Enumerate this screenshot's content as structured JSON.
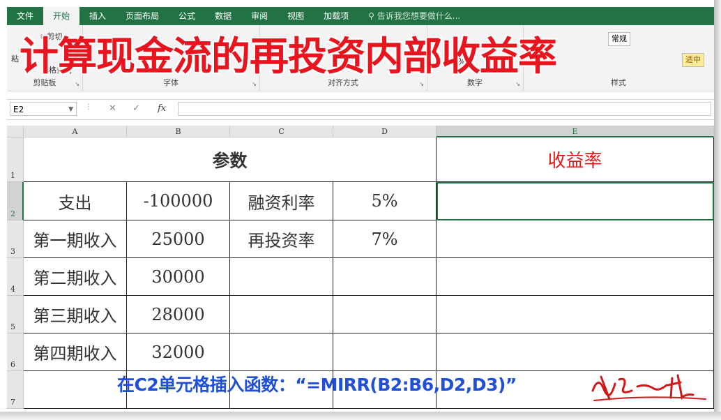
{
  "ribbon_tabs": [
    "文件",
    "开始",
    "插入",
    "页面布局",
    "公式",
    "数据",
    "审阅",
    "视图",
    "加载项"
  ],
  "tell_me": "告诉我您想要做什么...",
  "ribbon_groups": {
    "clipboard": "剪贴板",
    "font": "字体",
    "align": "对齐方式",
    "number": "数字",
    "styles": "样式"
  },
  "ribbon_snippets": {
    "cut": "剪切",
    "paste": "粘",
    "format_painter": "格式刷",
    "percent": "%",
    "style_label": "常规",
    "style_good": "适中"
  },
  "banner": "计算现金流的再投资内部收益率",
  "name_box": "E2",
  "formula_icons": {
    "cancel": "✕",
    "enter": "✓",
    "fx": "fx"
  },
  "column_headers": [
    "A",
    "B",
    "C",
    "D",
    "E"
  ],
  "row_headers": [
    "1",
    "2",
    "3",
    "4",
    "5",
    "6",
    "7"
  ],
  "cells": {
    "A1": "参数",
    "E1": "收益率",
    "A2": "支出",
    "B2": "-100000",
    "C2": "融资利率",
    "D2": "5%",
    "A3": "第一期收入",
    "B3": "25000",
    "C3": "再投资率",
    "D3": "7%",
    "A4": "第二期收入",
    "B4": "30000",
    "A5": "第三期收入",
    "B5": "28000",
    "A6": "第四期收入",
    "B6": "32000"
  },
  "caption": "在C2单元格插入函数：“=MIRR(B2:B6,D2,D3)”",
  "colors": {
    "excel_green": "#217346",
    "banner_red": "#e8141e",
    "caption_blue": "#1f4fd6",
    "rate_red": "#e21b1b"
  }
}
